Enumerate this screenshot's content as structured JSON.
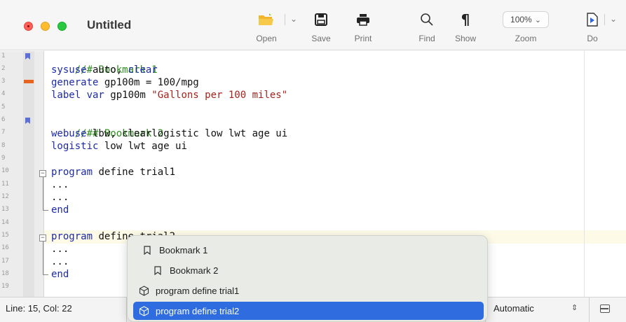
{
  "window": {
    "title": "Untitled"
  },
  "toolbar": {
    "items": [
      {
        "label": "Open",
        "icon": "folder-open-icon"
      },
      {
        "label": "Save",
        "icon": "save-icon"
      },
      {
        "label": "Print",
        "icon": "printer-icon"
      },
      {
        "label": "Find",
        "icon": "search-icon"
      },
      {
        "label": "Show",
        "icon": "pilcrow-icon"
      },
      {
        "label": "Zoom",
        "icon": "zoom-select"
      },
      {
        "label": "Do",
        "icon": "do-run-icon"
      }
    ],
    "zoom_value": "100%",
    "colors": {
      "folder": "#f2b52c"
    }
  },
  "editor": {
    "line_numbers": [
      "1",
      "2",
      "3",
      "4",
      "5",
      "6",
      "7",
      "8",
      "9",
      "10",
      "11",
      "12",
      "13",
      "14",
      "15",
      "16",
      "17",
      "18",
      "19"
    ],
    "lines": {
      "l1": {
        "comment": "//# Bookmark 1"
      },
      "l2": {
        "kw": "sysuse",
        "rest": " auto, ",
        "kw2": "clear"
      },
      "l3": {
        "kw": "generate",
        "rest": " gp100m = 100/mpg"
      },
      "l4": {
        "kw": "label var",
        "rest": " gp100m ",
        "str": "\"Gallons per 100 miles\""
      },
      "l6": {
        "comment": "//## Bookmark 2"
      },
      "l7": {
        "kw": "webuse",
        "rest": " lbw, clearlogistic low lwt age ui"
      },
      "l8": {
        "kw": "logistic",
        "rest": " low lwt age ui"
      },
      "l10": {
        "kw": "program",
        "rest": " define trial1"
      },
      "l11": {
        "text": "..."
      },
      "l12": {
        "text": "..."
      },
      "l13": {
        "kw": "end"
      },
      "l15": {
        "kw": "program",
        "rest": " defi",
        "hidden_rest": "ne trial2"
      },
      "l16": {
        "text": "..."
      },
      "l17": {
        "text": "..."
      },
      "l18": {
        "kw": "end"
      }
    },
    "colors": {
      "comment": "#2e8b1e",
      "keyword": "#1d2aa8",
      "string": "#a3241d",
      "bookmark": "#5b6fd6",
      "error_marker": "#e6641e",
      "current_line": "#fdfae8"
    }
  },
  "status": {
    "position": "Line: 15, Col: 22",
    "encoding": "Automatic"
  },
  "popup": {
    "items": [
      {
        "label": "Bookmark 1",
        "icon": "bookmark-icon",
        "selected": false
      },
      {
        "label": "Bookmark 2",
        "icon": "bookmark-icon",
        "selected": false
      },
      {
        "label": "program define trial1",
        "icon": "cube-icon",
        "selected": false
      },
      {
        "label": "program define trial2",
        "icon": "cube-icon",
        "selected": true
      }
    ],
    "colors": {
      "selection": "#2e6ce0",
      "background": "#e8ebe6"
    }
  }
}
